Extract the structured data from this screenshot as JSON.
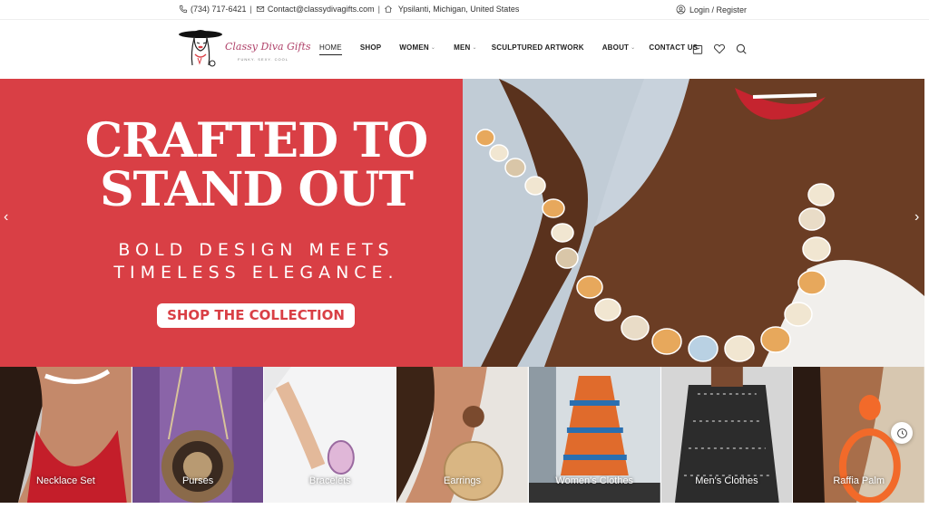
{
  "topbar": {
    "phone": "(734) 717-6421",
    "email": "Contact@classydivagifts.com",
    "location": "Ypsilanti, Michigan, United States",
    "login": "Login / Register"
  },
  "logo": {
    "text": "Classy Diva Gifts",
    "tagline": "FUNKY. SEXY. COOL"
  },
  "nav": {
    "home": "HOME",
    "shop": "SHOP",
    "women": "WOMEN",
    "men": "MEN",
    "sculptured": "SCULPTURED ARTWORK",
    "about": "ABOUT",
    "contact": "CONTACT US"
  },
  "hero": {
    "title_line1": "CRAFTED TO",
    "title_line2": "STAND OUT",
    "subtitle_line1": "BOLD DESIGN MEETS",
    "subtitle_line2": "TIMELESS ELEGANCE.",
    "button": "SHOP THE COLLECTION",
    "prev": "‹",
    "next": "›"
  },
  "categories": [
    {
      "label": "Necklace Set"
    },
    {
      "label": "Purses"
    },
    {
      "label": "Bracelets"
    },
    {
      "label": "Earrings"
    },
    {
      "label": "Women's Clothes"
    },
    {
      "label": "Men's Clothes"
    },
    {
      "label": "Raffia Palm"
    }
  ],
  "colors": {
    "accent": "#d93f45",
    "brand": "#b0426a"
  }
}
